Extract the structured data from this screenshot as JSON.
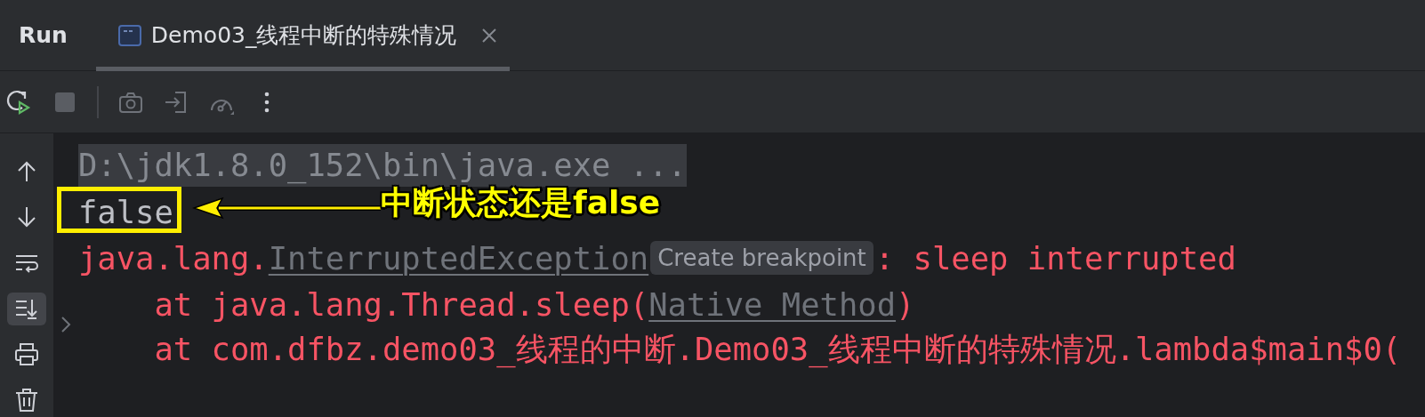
{
  "tool_window": {
    "title": "Run"
  },
  "tabs": [
    {
      "label": "Demo03_线程中断的特殊情况",
      "selected": true
    }
  ],
  "toolbar": [
    {
      "kind": "rerun",
      "disabled": false
    },
    {
      "kind": "stop",
      "disabled": true
    },
    {
      "kind": "separator"
    },
    {
      "kind": "camera",
      "disabled": true
    },
    {
      "kind": "exit",
      "disabled": true
    },
    {
      "kind": "gauge",
      "disabled": true
    },
    {
      "kind": "more",
      "disabled": false
    }
  ],
  "sidebar": [
    {
      "kind": "up",
      "selected": false
    },
    {
      "kind": "down",
      "selected": false
    },
    {
      "kind": "wrap",
      "selected": false
    },
    {
      "kind": "scroll-end",
      "selected": true
    },
    {
      "kind": "print",
      "selected": false
    },
    {
      "kind": "trash",
      "selected": false
    }
  ],
  "console": {
    "lines": [
      {
        "folded": false,
        "segments": [
          {
            "kind": "system",
            "text": "D:\\jdk1.8.0_152\\bin\\java.exe ..."
          }
        ]
      },
      {
        "folded": false,
        "highlighted": true,
        "segments": [
          {
            "kind": "output",
            "text": "false"
          }
        ]
      },
      {
        "folded": false,
        "segments": [
          {
            "kind": "error",
            "text": "java.lang."
          },
          {
            "kind": "link",
            "text": "InterruptedException"
          },
          {
            "kind": "hint",
            "text": "Create breakpoint"
          },
          {
            "kind": "error",
            "text": ": sleep interrupted"
          }
        ]
      },
      {
        "folded": false,
        "segments": [
          {
            "kind": "error",
            "text": "    at java.lang.Thread.sleep("
          },
          {
            "kind": "link",
            "text": "Native Method"
          },
          {
            "kind": "error",
            "text": ")"
          }
        ]
      },
      {
        "folded": true,
        "segments": [
          {
            "kind": "error",
            "text": "    at com.dfbz.demo03_线程的中断.Demo03_线程中断的特殊情况.lambda$main$0("
          }
        ]
      }
    ]
  },
  "annotation": {
    "label": "中断状态还是false"
  }
}
